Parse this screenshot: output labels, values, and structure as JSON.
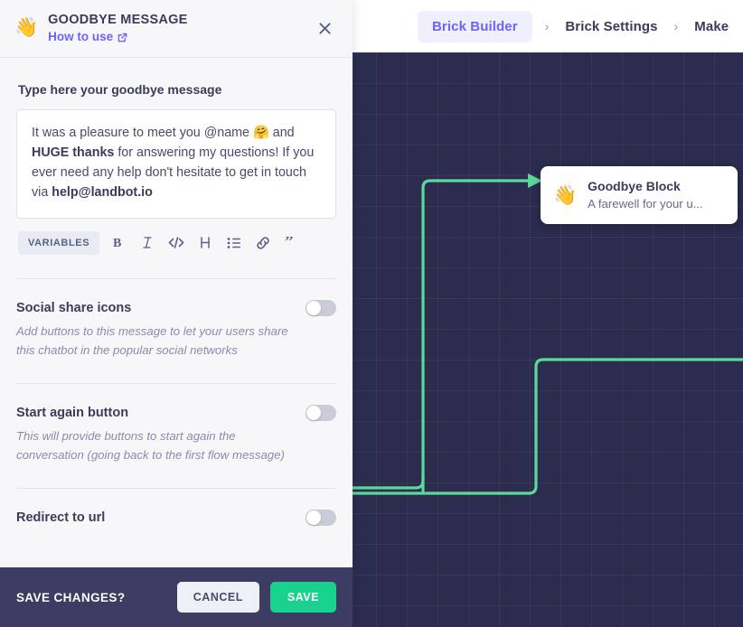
{
  "breadcrumb": {
    "items": [
      {
        "label": "Brick Builder",
        "active": true
      },
      {
        "label": "Brick Settings",
        "active": false
      },
      {
        "label": "Make",
        "active": false
      }
    ],
    "separator": "›",
    "active_color": "#6c63ff",
    "active_bg": "#f0effe"
  },
  "panel": {
    "emoji": "👋",
    "title": "GOODBYE MESSAGE",
    "howto_label": "How to use",
    "howto_icon": "external-link-icon",
    "close_icon": "close-icon",
    "message_label": "Type here your goodbye message",
    "message": {
      "line1_pre": "It was a pleasure to meet you @name ",
      "emoji": "🤗",
      "line1_post": " and ",
      "bold1": "HUGE thanks",
      "mid": " for answering my questions! If you ever need any help don't hesitate to get in touch via ",
      "bold2": "help@landbot.io"
    },
    "toolbar": {
      "variables_label": "VARIABLES",
      "icons": [
        {
          "name": "bold-icon",
          "glyph": "B"
        },
        {
          "name": "italic-icon",
          "glyph": "I"
        },
        {
          "name": "code-icon",
          "glyph": "</>"
        },
        {
          "name": "heading-icon",
          "glyph": "H"
        },
        {
          "name": "bullet-list-icon",
          "glyph": "☰"
        },
        {
          "name": "link-icon",
          "glyph": "🔗"
        },
        {
          "name": "quote-icon",
          "glyph": "”"
        }
      ]
    },
    "settings": [
      {
        "title": "Social share icons",
        "desc": "Add buttons to this message to let your users share this chatbot in the popular social networks",
        "enabled": false
      },
      {
        "title": "Start again button",
        "desc": "This will provide buttons to start again the conversation (going back to the first flow message)",
        "enabled": false
      },
      {
        "title": "Redirect to url",
        "desc": "",
        "enabled": false
      }
    ],
    "save_bar": {
      "question": "SAVE CHANGES?",
      "cancel_label": "CANCEL",
      "save_label": "SAVE",
      "save_color": "#19d28d"
    }
  },
  "canvas": {
    "background_color": "#2b2c4e",
    "grid_size": 34,
    "connector_color": "#5cd89b",
    "block": {
      "emoji": "👋",
      "title": "Goodbye Block",
      "subtitle": "A farewell for your u..."
    }
  }
}
